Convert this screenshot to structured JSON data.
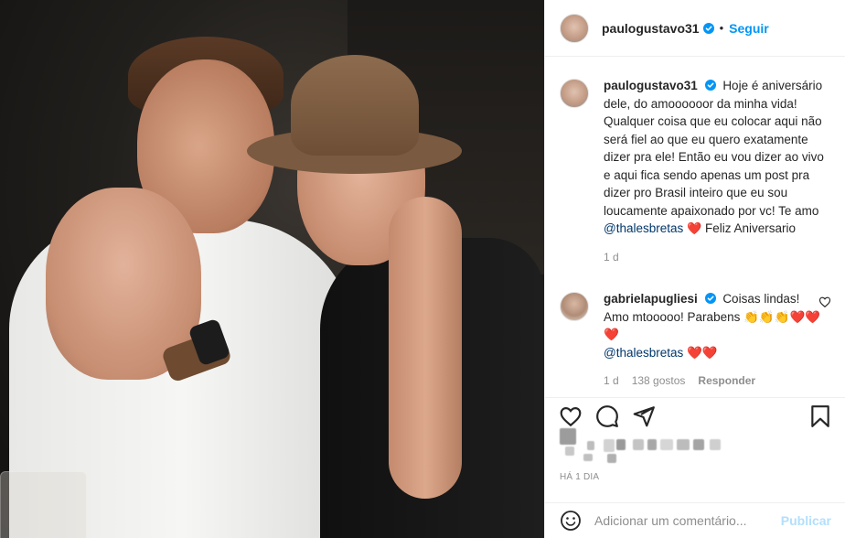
{
  "post": {
    "username": "paulogustavo31",
    "verified": true,
    "follow_label": "Seguir",
    "separator": "•"
  },
  "caption": {
    "username": "paulogustavo31",
    "text": "Hoje é aniversário dele, do amoooooor da minha vida! Qualquer coisa que eu colocar aqui não será fiel ao que eu quero exatamente dizer pra ele! Então eu vou dizer ao vivo e aqui fica sendo apenas um post pra dizer pro Brasil inteiro que eu sou loucamente apaixonado por vc! Te amo",
    "mention": "@thalesbretas",
    "heart": "❤️",
    "text_after": "Feliz Aniversario",
    "time": "1 d"
  },
  "comment": {
    "username": "gabrielapugliesi",
    "text": "Coisas lindas! Amo mtooooo! Parabens",
    "emojis": "👏👏👏❤️❤️❤️",
    "mention": "@thalesbretas",
    "emojis_after": "❤️❤️",
    "time": "1 d",
    "likes": "138 gostos",
    "reply_label": "Responder"
  },
  "actions": {
    "like_icon": "heart-outline-icon",
    "comment_icon": "comment-bubble-icon",
    "share_icon": "paper-plane-icon",
    "save_icon": "bookmark-icon"
  },
  "timestamp": "HÁ 1 DIA",
  "add_comment": {
    "placeholder": "Adicionar um comentário...",
    "publish_label": "Publicar"
  },
  "colors": {
    "accent": "#0095f6",
    "publish_disabled": "#b2dffc",
    "muted": "#8e8e8e",
    "text": "#262626",
    "heart": "#ed1c24"
  }
}
